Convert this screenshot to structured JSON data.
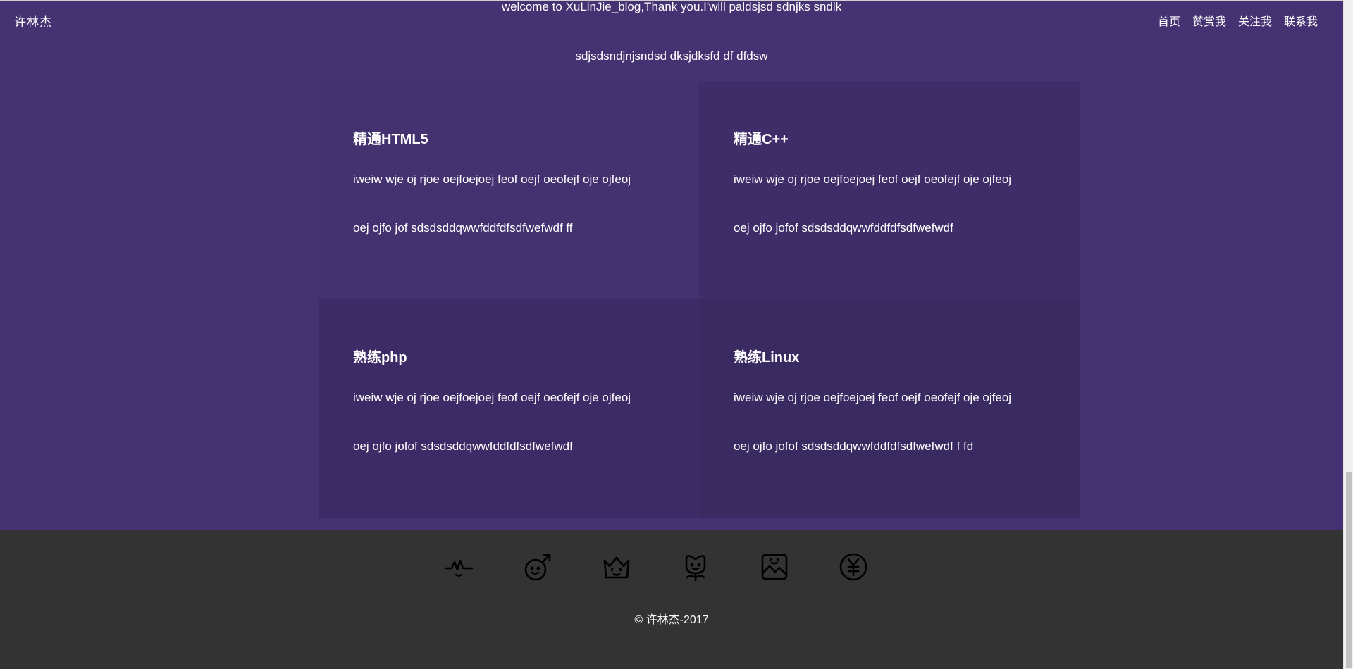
{
  "header": {
    "brand": "许林杰",
    "nav": [
      "首页",
      "赞赏我",
      "关注我",
      "联系我"
    ]
  },
  "intro": {
    "line1": "welcome to XuLinJie_blog,Thank you.I'will paldsjsd sdnjks sndlk",
    "line2": "sdjsdsndjnjsndsd dksjdksfd df dfdsw"
  },
  "skills": [
    {
      "title": "精通HTML5",
      "line1": "iweiw wje oj rjoe oejfoejoej feof oejf oeofejf oje ojfeoj",
      "line2": "oej ojfo jof sdsdsddqwwfddfdfsdfwefwdf ff"
    },
    {
      "title": "精通C++",
      "line1": "iweiw wje oj rjoe oejfoejoej feof oejf oeofejf oje ojfeoj",
      "line2": "oej ojfo jofof sdsdsddqwwfddfdfsdfwefwdf"
    },
    {
      "title": "熟练php",
      "line1": "iweiw wje oj rjoe oejfoejoej feof oejf oeofejf oje ojfeoj",
      "line2": "oej ojfo jofof sdsdsddqwwfddfdfsdfwefwdf"
    },
    {
      "title": "熟练Linux",
      "line1": "iweiw wje oj rjoe oejfoejoej feof oejf oeofejf oje ojfeoj",
      "line2": "oej ojfo jofof sdsdsddqwwfddfdfsdfwefwdf f fd"
    }
  ],
  "footer": {
    "icons": [
      "pulse-icon",
      "male-smile-icon",
      "crown-icon",
      "flower-icon",
      "image-icon",
      "yen-icon"
    ],
    "copyright": "© 许林杰-2017"
  },
  "colors": {
    "purple": "#443272",
    "footer": "#333333"
  }
}
